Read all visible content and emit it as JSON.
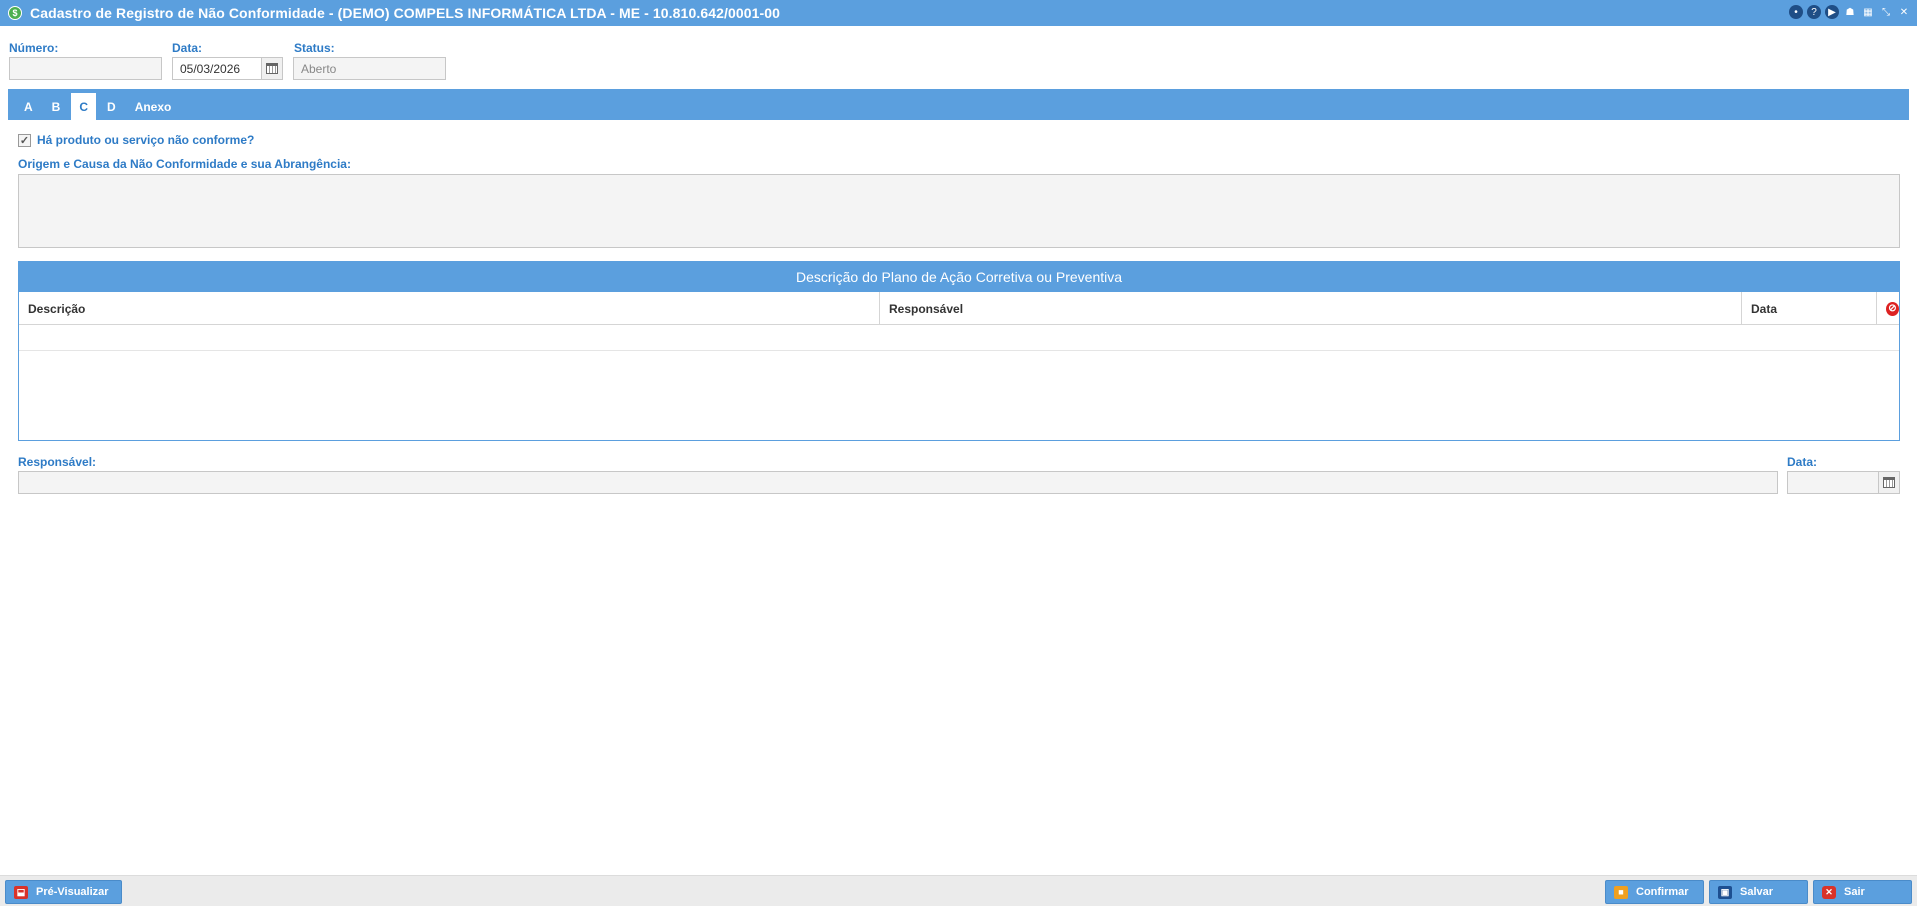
{
  "window": {
    "title": "Cadastro de Registro de Não Conformidade - (DEMO) COMPELS INFORMÁTICA LTDA - ME - 10.810.642/0001-00"
  },
  "header_fields": {
    "numero": {
      "label": "Número:",
      "value": ""
    },
    "data": {
      "label": "Data:",
      "value": "05/03/2026"
    },
    "status": {
      "label": "Status:",
      "value": "Aberto"
    }
  },
  "tabs": [
    {
      "label": "A"
    },
    {
      "label": "B"
    },
    {
      "label": "C",
      "active": true
    },
    {
      "label": "D"
    },
    {
      "label": "Anexo"
    }
  ],
  "tab_c": {
    "checkbox_label": "Há produto ou serviço não conforme?",
    "checkbox_checked": true,
    "origem_label": "Origem e Causa da Não Conformidade e sua Abrangência:",
    "origem_value": ""
  },
  "action_plan": {
    "title": "Descrição do Plano de Ação Corretiva ou Preventiva",
    "columns": [
      "Descrição",
      "Responsável",
      "Data"
    ],
    "rows": []
  },
  "bottom_fields": {
    "responsavel": {
      "label": "Responsável:",
      "value": ""
    },
    "data": {
      "label": "Data:",
      "value": ""
    }
  },
  "footer": {
    "preview_label": "Pré-Visualizar",
    "confirm_label": "Confirmar",
    "save_label": "Salvar",
    "exit_label": "Sair"
  },
  "colors": {
    "accent": "#5b9fde",
    "label": "#2e7bc6"
  }
}
